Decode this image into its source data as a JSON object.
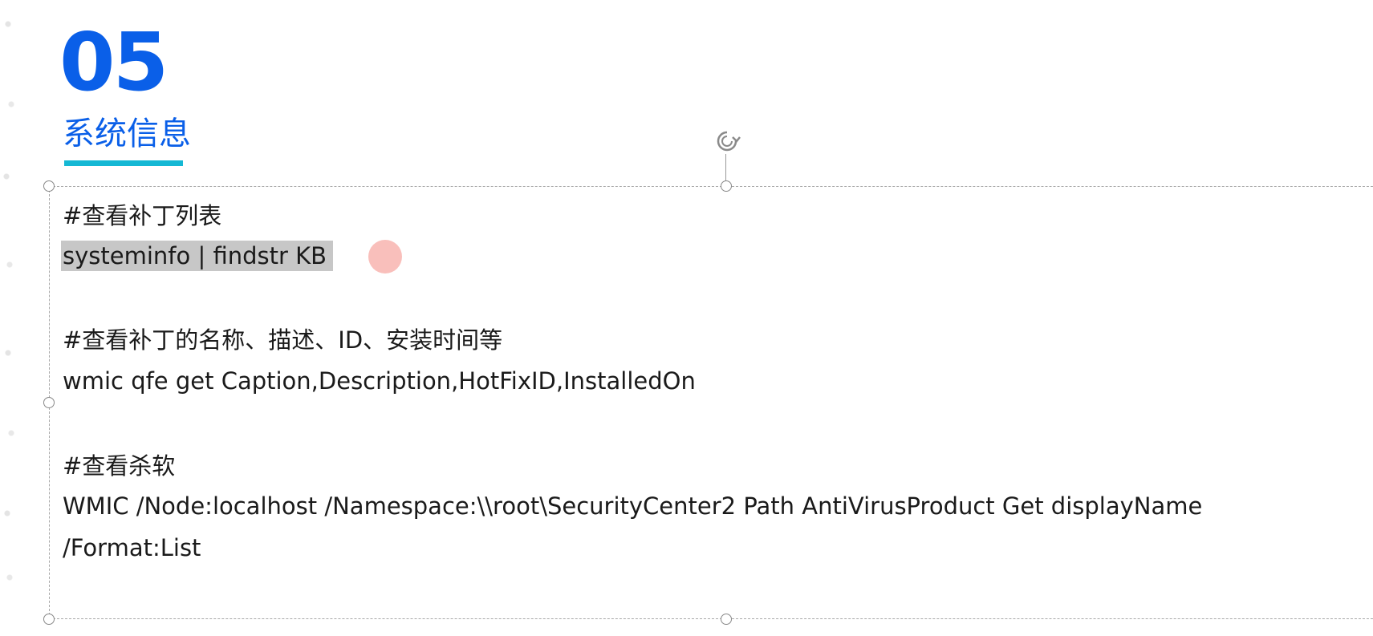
{
  "slide": {
    "section_number": "05",
    "section_title": "系统信息"
  },
  "content": {
    "patch_list_comment": "#查看补丁列表",
    "patch_list_command": "systeminfo | findstr KB",
    "patch_details_comment": "#查看补丁的名称、描述、ID、安装时间等",
    "patch_details_command": "wmic qfe get Caption,Description,HotFixID,InstalledOn",
    "antivirus_comment": "#查看杀软",
    "antivirus_command_line1": "WMIC /Node:localhost /Namespace:\\\\root\\SecurityCenter2 Path AntiVirusProduct Get displayName",
    "antivirus_command_line2": "/Format:List"
  },
  "colors": {
    "accent_blue": "#0a5fe8",
    "underline_cyan": "#15b8d4",
    "selection_gray": "#c7c7c7",
    "cursor_pink": "#f9bfbb"
  },
  "icons": {
    "rotate": "rotate-handle-icon"
  }
}
